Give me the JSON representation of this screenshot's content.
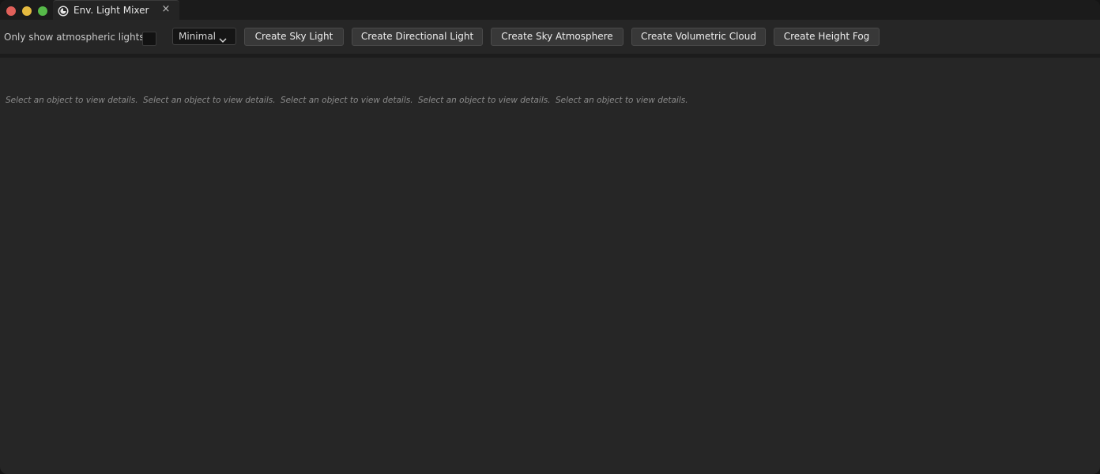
{
  "window": {
    "tab": {
      "label": "Env. Light Mixer",
      "icon": "env-light-mixer-icon",
      "close_glyph": "×"
    },
    "traffic_lights": {
      "close_color": "#e0605a",
      "minimize_color": "#e4b93f",
      "maximize_color": "#56b949"
    }
  },
  "toolbar": {
    "filter_label": "Only show atmospheric lights",
    "filter_checked": false,
    "view_mode": {
      "selected": "Minimal",
      "icon": "chevron-down-icon"
    },
    "buttons": [
      {
        "label": "Create Sky Light"
      },
      {
        "label": "Create Directional Light"
      },
      {
        "label": "Create Sky Atmosphere"
      },
      {
        "label": "Create Volumetric Cloud"
      },
      {
        "label": "Create Height Fog"
      }
    ]
  },
  "details_panels": [
    {
      "message": "Select an object to view details."
    },
    {
      "message": "Select an object to view details."
    },
    {
      "message": "Select an object to view details."
    },
    {
      "message": "Select an object to view details."
    },
    {
      "message": "Select an object to view details."
    }
  ]
}
